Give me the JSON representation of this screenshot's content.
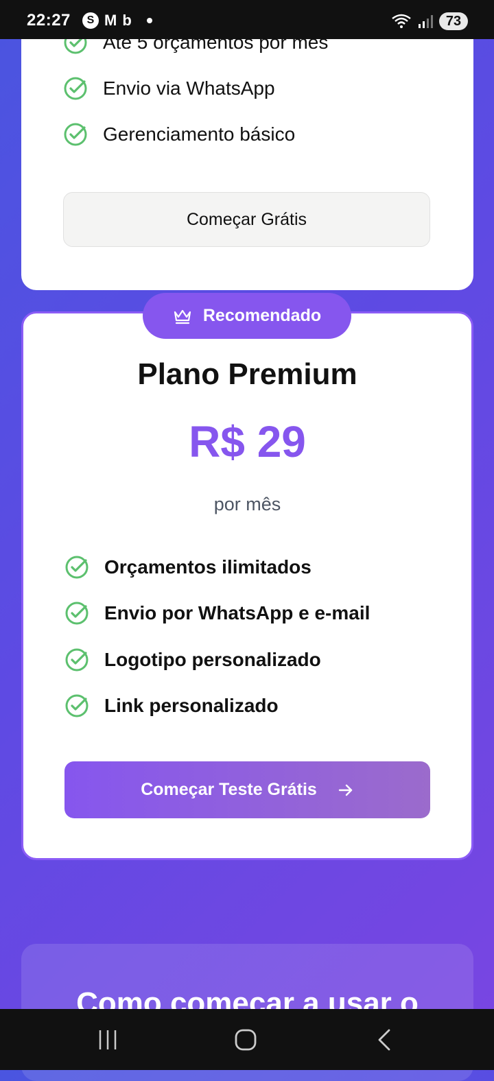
{
  "status_bar": {
    "time": "22:27",
    "left_icons": [
      "s-app-icon",
      "gmail-icon",
      "bing-icon",
      "notification-dot"
    ],
    "s_icon_glyph": "S",
    "m_icon_glyph": "M",
    "b_icon_glyph": "b",
    "battery": "73"
  },
  "free_plan": {
    "features": [
      "Até 5 orçamentos por mês",
      "Envio via WhatsApp",
      "Gerenciamento básico"
    ],
    "button_label": "Começar Grátis"
  },
  "premium_plan": {
    "badge_label": "Recomendado",
    "title": "Plano Premium",
    "price": "R$ 29",
    "period": "por mês",
    "features": [
      "Orçamentos ilimitados",
      "Envio por WhatsApp e e-mail",
      "Logotipo personalizado",
      "Link personalizado"
    ],
    "button_label": "Começar Teste Grátis",
    "accent_color": "#8656ee"
  },
  "next_section": {
    "title": "Como começar a usar o"
  },
  "colors": {
    "check_green": "#5cc06e",
    "background_start": "#4a55e0",
    "background_end": "#7a45e2"
  },
  "nav_bar": {
    "items": [
      "recents-icon",
      "home-icon",
      "back-icon"
    ]
  }
}
